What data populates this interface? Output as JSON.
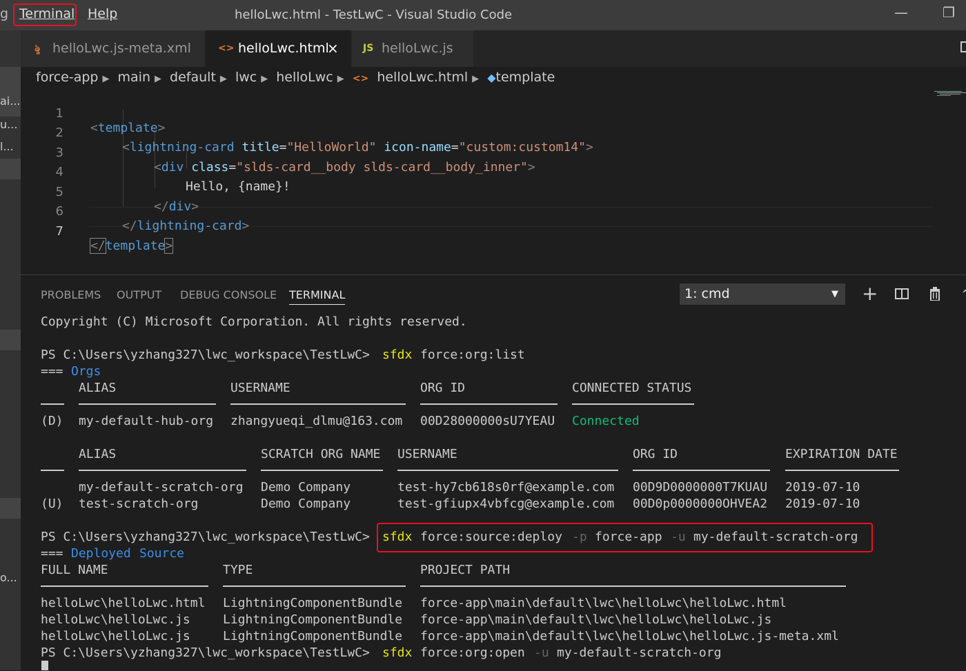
{
  "menu": {
    "clipped": "g",
    "terminal": "Terminal",
    "help": "Help"
  },
  "window": {
    "title": "helloLwc.html - TestLwC - Visual Studio Code",
    "minimize": "—",
    "restore": "❐"
  },
  "activity": {
    "labels": [
      "ai...",
      "u...",
      "l...",
      "o..."
    ]
  },
  "tabs": [
    {
      "label": "helloLwc.js-meta.xml",
      "icon": "xml-rss-icon"
    },
    {
      "label": "helloLwc.html",
      "icon": "html-brackets-icon",
      "close": "×"
    },
    {
      "label": "helloLwc.js",
      "icon": "JS"
    }
  ],
  "breadcrumb": [
    "force-app",
    "main",
    "default",
    "lwc",
    "helloLwc",
    "helloLwc.html",
    "template"
  ],
  "editor": {
    "line_numbers": [
      "1",
      "2",
      "3",
      "4",
      "5",
      "6",
      "7"
    ],
    "lines": [
      {
        "t1": "<",
        "n1": "template",
        "t2": ">"
      },
      {
        "t1": "<",
        "n1": "lightning-card",
        "a1": " title",
        "eq1": "=",
        "s1": "\"HelloWorld\"",
        "a2": " icon-name",
        "eq2": "=",
        "s2": "\"custom:custom14\"",
        "t2": ">"
      },
      {
        "t1": "<",
        "n1": "div",
        "a1": " class",
        "eq1": "=",
        "s1": "\"slds-card__body slds-card__body_inner\"",
        "t2": ">"
      },
      {
        "txt": "Hello, {name}!"
      },
      {
        "t1": "</",
        "n1": "div",
        "t2": ">"
      },
      {
        "t1": "</",
        "n1": "lightning-card",
        "t2": ">"
      },
      {
        "t1": "</",
        "n1": "template",
        "t2": ">"
      }
    ]
  },
  "panel": {
    "tabs": [
      "PROBLEMS",
      "OUTPUT",
      "DEBUG CONSOLE",
      "TERMINAL"
    ],
    "terminal_select": "1: cmd",
    "icons": [
      "plus-icon",
      "split-icon",
      "trash-icon",
      "chevron-up-icon"
    ]
  },
  "terminal": {
    "copyright": "Copyright (C) Microsoft Corporation. All rights reserved.",
    "prompt": "PS C:\\Users\\yzhang327\\lwc_workspace\\TestLwC>",
    "cmd_sfdx": "sfdx",
    "cmd1_rest": "force:org:list",
    "orgs_prefix": "===",
    "orgs_title": "Orgs",
    "table1": {
      "headers": [
        "ALIAS",
        "USERNAME",
        "ORG ID",
        "CONNECTED STATUS"
      ],
      "row": {
        "mark": "(D)",
        "alias": "my-default-hub-org",
        "username": "zhangyueqi_dlmu@163.com",
        "orgid": "00D28000000sU7YEAU",
        "status": "Connected"
      }
    },
    "table2": {
      "headers": [
        "ALIAS",
        "SCRATCH ORG NAME",
        "USERNAME",
        "ORG ID",
        "EXPIRATION DATE"
      ],
      "rows": [
        {
          "mark": "",
          "alias": "my-default-scratch-org",
          "name": "Demo Company",
          "username": "test-hy7cb618s0rf@example.com",
          "orgid": "00D9D0000000T7KUAU",
          "exp": "2019-07-10"
        },
        {
          "mark": "(U)",
          "alias": "test-scratch-org",
          "name": "Demo Company",
          "username": "test-gfiupx4vbfcg@example.com",
          "orgid": "00D0p0000000OHVEA2",
          "exp": "2019-07-10"
        }
      ]
    },
    "cmd2": {
      "sub": "force:source:deploy",
      "flag_p": "-p",
      "val_p": "force-app",
      "flag_u": "-u",
      "val_u": "my-default-scratch-org"
    },
    "deployed_prefix": "===",
    "deployed_w1": "Deployed",
    "deployed_w2": "Source",
    "table3": {
      "headers": [
        "FULL NAME",
        "TYPE",
        "PROJECT PATH"
      ],
      "rows": [
        {
          "name": "helloLwc\\helloLwc.html",
          "type": "LightningComponentBundle",
          "path": "force-app\\main\\default\\lwc\\helloLwc\\helloLwc.html"
        },
        {
          "name": "helloLwc\\helloLwc.js",
          "type": "LightningComponentBundle",
          "path": "force-app\\main\\default\\lwc\\helloLwc\\helloLwc.js"
        },
        {
          "name": "helloLwc\\helloLwc.js",
          "type": "LightningComponentBundle",
          "path": "force-app\\main\\default\\lwc\\helloLwc\\helloLwc.js-meta.xml"
        }
      ]
    },
    "cmd3": {
      "sub": "force:org:open",
      "flag_u": "-u",
      "val_u": "my-default-scratch-org"
    }
  }
}
